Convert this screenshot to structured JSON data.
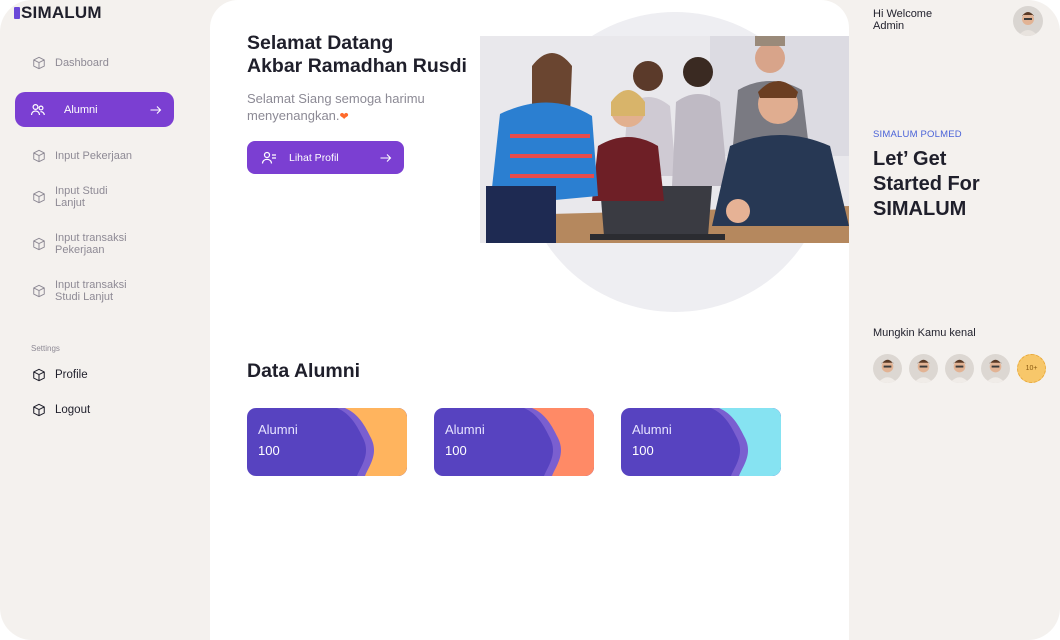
{
  "app": {
    "logo": "SIMALUM"
  },
  "sidebar": {
    "items": [
      {
        "label": "Dashboard",
        "icon": "cube-icon"
      },
      {
        "label": "Alumni",
        "icon": "users-icon",
        "active": true
      },
      {
        "label": "Input Pekerjaan",
        "icon": "cube-icon"
      },
      {
        "label": "Input Studi\nLanjut",
        "icon": "cube-icon"
      },
      {
        "label": "Input transaksi\nPekerjaan",
        "icon": "cube-icon"
      },
      {
        "label": "Input transaksi\nStudi Lanjut",
        "icon": "cube-icon"
      }
    ],
    "settings_title": "Settings",
    "settings_items": [
      {
        "label": "Profile",
        "icon": "cube-icon"
      },
      {
        "label": "Logout",
        "icon": "cube-icon"
      }
    ]
  },
  "main": {
    "greeting": "Selamat Datang\nAkbar Ramadhan Rusdi",
    "subtitle": "Selamat Siang semoga harimu\nmenyenangkan.",
    "profile_button": "Lihat Profil",
    "section_title": "Data Alumni",
    "cards": [
      {
        "label": "Alumni",
        "value": "100",
        "accent": "#ffb45e"
      },
      {
        "label": "Alumni",
        "value": "100",
        "accent": "#ff8a66"
      },
      {
        "label": "Alumni",
        "value": "100",
        "accent": "#86e3f2"
      }
    ]
  },
  "right": {
    "welcome": "Hi Welcome\nAdmin",
    "promo_tag": "SIMALUM POLMED",
    "promo_title": "Let’ Get\nStarted For\nSIMALUM",
    "know_title": "Mungkin Kamu kenal",
    "more_count": "10+"
  },
  "colors": {
    "primary": "#7b3fd2",
    "card_bg": "#5743c0",
    "panel_bg": "#f4f1ee"
  }
}
